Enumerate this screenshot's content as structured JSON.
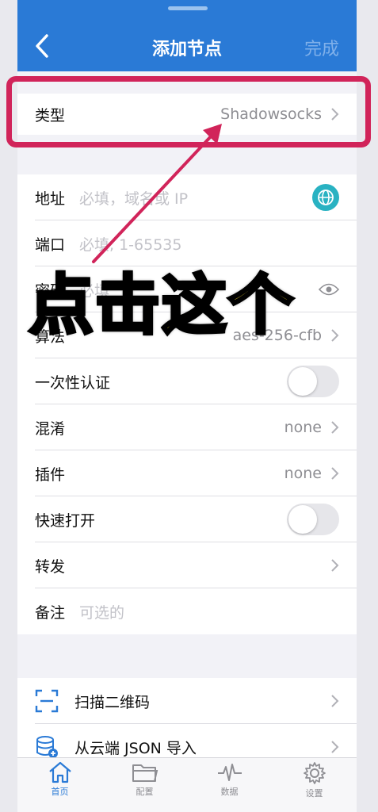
{
  "header": {
    "title": "添加节点",
    "done_label": "完成"
  },
  "type_row": {
    "label": "类型",
    "value": "Shadowsocks"
  },
  "fields": {
    "address": {
      "label": "地址",
      "placeholder": "必填，域名或 IP"
    },
    "port": {
      "label": "端口",
      "placeholder": "必填, 1-65535"
    },
    "password": {
      "label": "密码",
      "placeholder": "必填"
    },
    "algorithm": {
      "label": "算法",
      "value": "aes-256-cfb"
    },
    "ota": {
      "label": "一次性认证",
      "enabled": false
    },
    "obfs": {
      "label": "混淆",
      "value": "none"
    },
    "plugin": {
      "label": "插件",
      "value": "none"
    },
    "fast_open": {
      "label": "快速打开",
      "enabled": false
    },
    "forward": {
      "label": "转发"
    },
    "remark": {
      "label": "备注",
      "placeholder": "可选的"
    }
  },
  "import": {
    "scan_qr": "扫描二维码",
    "cloud_json": "从云端 JSON 导入"
  },
  "tabs": [
    {
      "label": "首页",
      "icon": "home-icon",
      "active": true
    },
    {
      "label": "配置",
      "icon": "folder-icon",
      "active": false
    },
    {
      "label": "数据",
      "icon": "pulse-icon",
      "active": false
    },
    {
      "label": "设置",
      "icon": "gear-icon",
      "active": false
    }
  ],
  "annotation": {
    "overlay_text": "点击这个",
    "highlight_color": "#d1245a",
    "text_color": "#ffe22a"
  },
  "colors": {
    "accent": "#2a7ad6",
    "globe": "#29b2c2"
  }
}
